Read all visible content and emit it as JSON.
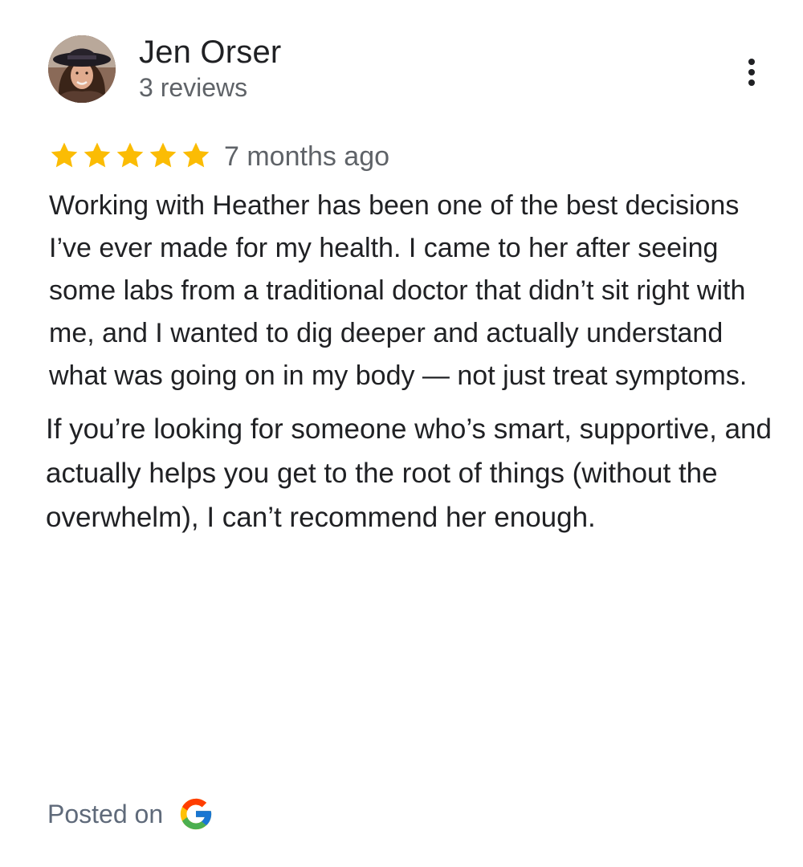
{
  "review": {
    "reviewer_name": "Jen Orser",
    "review_count": "3 reviews",
    "rating": 5,
    "rating_max": 5,
    "time_ago": "7 months ago",
    "paragraphs": [
      "Working with Heather has been one of the best decisions I’ve ever made for my health. I came to her after seeing some labs from a traditional doctor that didn’t sit right with me, and I wanted to dig deeper and actually understand what was going on in my body — not just treat symptoms.",
      "If you’re looking for someone who’s smart, supportive, and actually helps you get to the root of things (without the overwhelm), I can’t recommend her enough."
    ],
    "footer": {
      "posted_label": "Posted on",
      "source_icon": "google-logo-icon"
    },
    "menu_icon": "more-vertical-icon"
  },
  "colors": {
    "star": "#FBBC04",
    "primary_text": "#202124",
    "secondary_text": "#5f6368",
    "footer_text": "#5f6a7a",
    "google_blue": "#4285F4",
    "google_red": "#EA4335",
    "google_yellow": "#FBBC05",
    "google_green": "#34A853"
  }
}
